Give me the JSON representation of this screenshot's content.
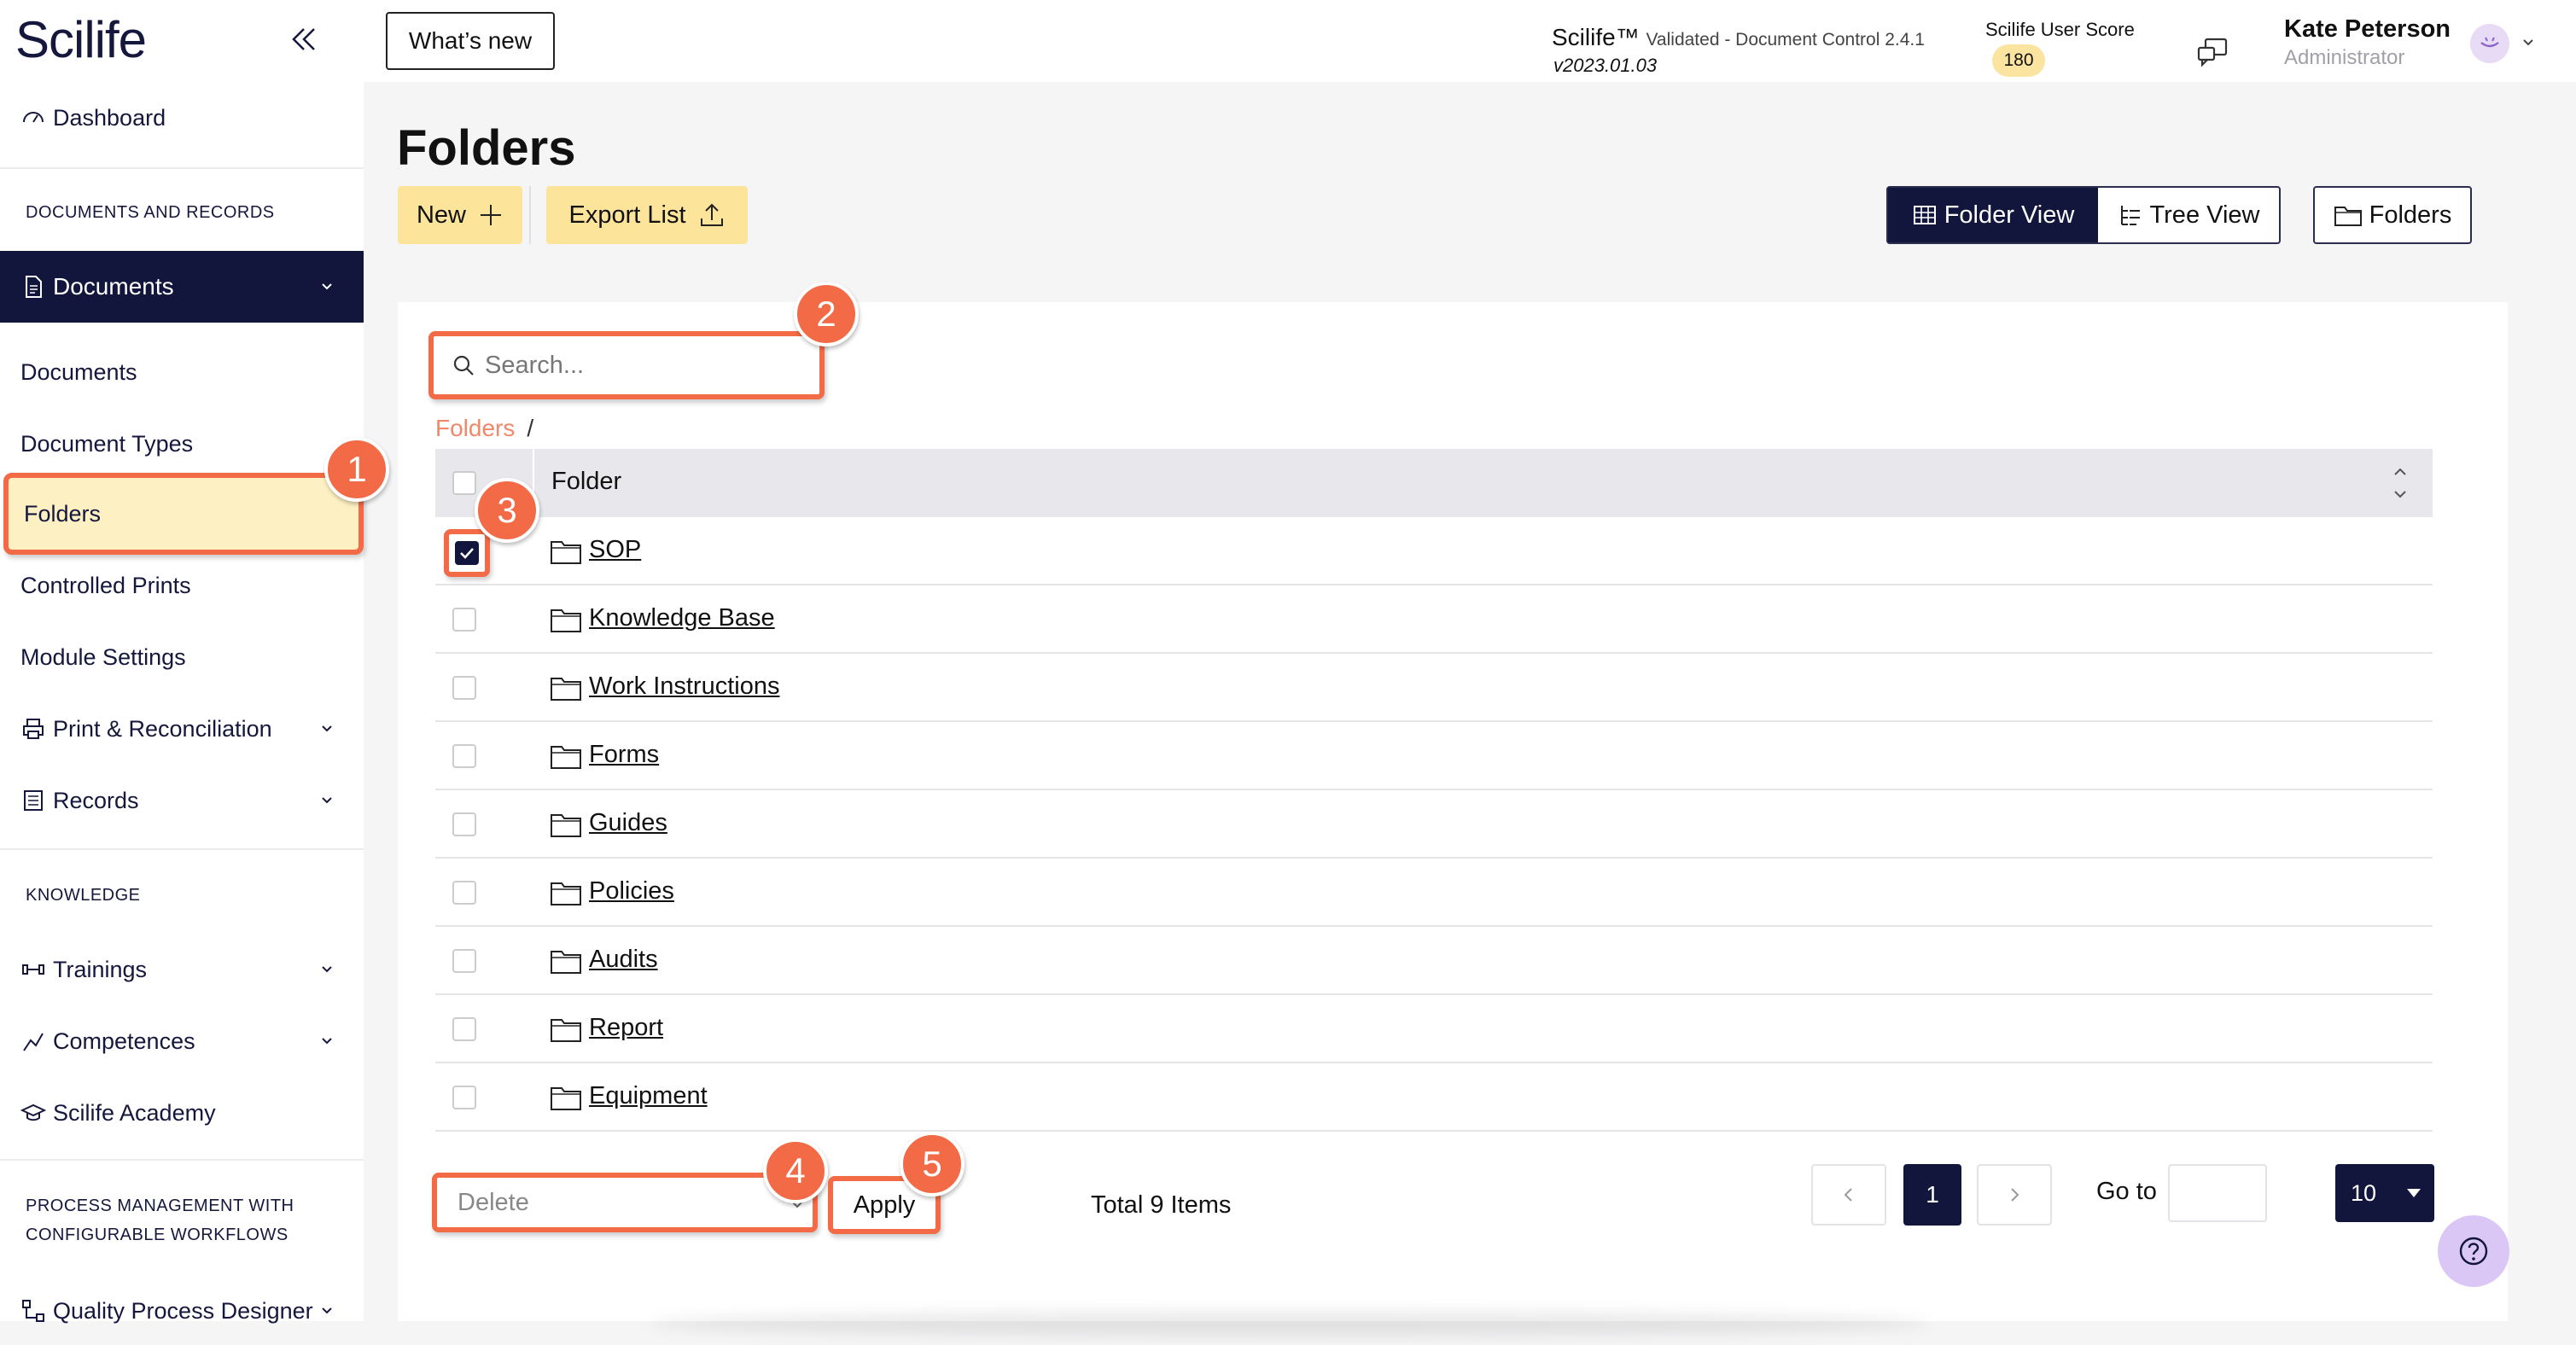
{
  "app": {
    "logo": "Scilife"
  },
  "sidebar": {
    "dashboard": "Dashboard",
    "section_docs": "DOCUMENTS AND RECORDS",
    "documents_group": "Documents",
    "sub_items": [
      "Documents",
      "Document Types",
      "Folders",
      "Controlled Prints",
      "Module Settings"
    ],
    "print_reconciliation": "Print & Reconciliation",
    "records": "Records",
    "section_knowledge": "KNOWLEDGE",
    "trainings": "Trainings",
    "competences": "Competences",
    "academy": "Scilife Academy",
    "section_process_1": "PROCESS MANAGEMENT WITH",
    "section_process_2": "CONFIGURABLE WORKFLOWS",
    "quality_process": "Quality Process Designer"
  },
  "topbar": {
    "whats_new": "What’s new",
    "product": "Scilife™",
    "product_sub": "Validated - Document Control 2.4.1",
    "version": "v2023.01.03",
    "score_label": "Scilife User Score",
    "score_value": "180",
    "user_name": "Kate Peterson",
    "user_role": "Administrator"
  },
  "main": {
    "title": "Folders",
    "new_label": "New",
    "export_label": "Export List",
    "folder_view": "Folder View",
    "tree_view": "Tree View",
    "folders_btn": "Folders",
    "search_placeholder": "Search...",
    "breadcrumb": "Folders",
    "breadcrumb_sep": "/",
    "column_folder": "Folder",
    "rows": [
      "SOP",
      "Knowledge Base",
      "Work Instructions",
      "Forms",
      "Guides",
      "Policies",
      "Audits",
      "Report",
      "Equipment"
    ],
    "checked_row": "SOP",
    "bulk_action": "Delete",
    "apply": "Apply",
    "total": "Total 9 Items",
    "current_page": "1",
    "goto_label": "Go to",
    "page_size": "10"
  },
  "annotations": [
    "1",
    "2",
    "3",
    "4",
    "5"
  ],
  "colors": {
    "accent": "#f26b46",
    "navy": "#12163c",
    "yellow": "#fce49a"
  }
}
